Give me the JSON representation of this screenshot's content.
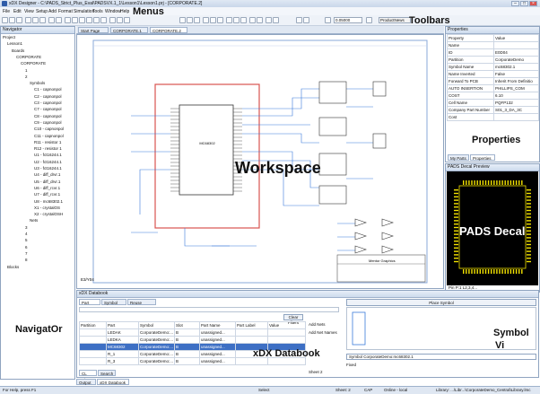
{
  "window": {
    "title": "xDX Designer - C:\\PADS_Strict_Plus_Eval\\PADSVX.1_1\\Lesson1\\Lesson1.prj - [CORPORATE.2]",
    "min": "–",
    "max": "□",
    "close": "×"
  },
  "annotations": {
    "menus": "Menus",
    "toolbars": "Toolbars",
    "workspace": "Workspace",
    "navigator": "NavigatOr",
    "properties": "Properties",
    "pads_decal": "PADS Decal",
    "symbol": "Symbol",
    "symbol_line2": "Vi",
    "xdx_database": "xDX Databook"
  },
  "menu": [
    "File",
    "Edit",
    "View",
    "Setup",
    "Add",
    "Format",
    "Simulation",
    "Tools",
    "Window",
    "Help"
  ],
  "toolbar": {
    "zoom_value": "0.05000",
    "product_name": "ProductNews"
  },
  "navigator": {
    "header": "Navigator",
    "tree": [
      {
        "label": "Project",
        "depth": 0
      },
      {
        "label": "Lesson1",
        "depth": 1
      },
      {
        "label": "Boards",
        "depth": 2
      },
      {
        "label": "CORPORATE",
        "depth": 3
      },
      {
        "label": "CORPORATE",
        "depth": 4
      },
      {
        "label": "1",
        "depth": 5
      },
      {
        "label": "2",
        "depth": 5
      },
      {
        "label": "Symbols",
        "depth": 6
      },
      {
        "label": "C1 - capnonpol",
        "depth": 7
      },
      {
        "label": "C2 - capnonpol",
        "depth": 7
      },
      {
        "label": "C3 - capnonpol",
        "depth": 7
      },
      {
        "label": "C7 - capnonpol",
        "depth": 7
      },
      {
        "label": "C8 - capnonpol",
        "depth": 7
      },
      {
        "label": "C9 - capnonpol",
        "depth": 7
      },
      {
        "label": "C10 - capnonpol",
        "depth": 7
      },
      {
        "label": "C11 - capnonpol",
        "depth": 7
      },
      {
        "label": "R11 - resistor 1",
        "depth": 7
      },
      {
        "label": "R12 - resistor 1",
        "depth": 7
      },
      {
        "label": "U1 - fct16244.1",
        "depth": 7
      },
      {
        "label": "U2 - fct16244.1",
        "depth": 7
      },
      {
        "label": "U3 - fct16244.1",
        "depth": 7
      },
      {
        "label": "U4 - diff_drvr.1",
        "depth": 7
      },
      {
        "label": "U5 - diff_drvr.1",
        "depth": 7
      },
      {
        "label": "U6 - diff_rcvr.1",
        "depth": 7
      },
      {
        "label": "U7 - diff_rcvr.1",
        "depth": 7
      },
      {
        "label": "U8 - mc68302.1",
        "depth": 7
      },
      {
        "label": "X1 - crystalOS",
        "depth": 7
      },
      {
        "label": "X2 - crystalOSH",
        "depth": 7
      },
      {
        "label": "Nets",
        "depth": 6
      },
      {
        "label": "3",
        "depth": 5
      },
      {
        "label": "4",
        "depth": 5
      },
      {
        "label": "5",
        "depth": 5
      },
      {
        "label": "6",
        "depth": 5
      },
      {
        "label": "7",
        "depth": 5
      },
      {
        "label": "8",
        "depth": 5
      },
      {
        "label": "Blocks",
        "depth": 1
      }
    ]
  },
  "doc_tabs": [
    "Start Page",
    "CORPORATE.1",
    "CORPORATE.2"
  ],
  "schematic": {
    "sheet_label": "E3/Y04",
    "title_block": "Mentor Graphics",
    "chip_label": "MC68302"
  },
  "properties": {
    "header": "Properties",
    "col_property": "Property",
    "col_value": "Value",
    "rows": [
      {
        "name": "Name",
        "value": ""
      },
      {
        "name": "ID",
        "value": "E0D04"
      },
      {
        "name": "Partition",
        "value": "CorporateDemo"
      },
      {
        "name": "Symbol Name",
        "value": "mc68302.1"
      },
      {
        "name": "Name Inverted",
        "value": "False"
      },
      {
        "name": "Forward To PCB",
        "value": "Inherit From Definitio"
      },
      {
        "name": "AUTO INSERTION",
        "value": "PHILLIPS_COM"
      },
      {
        "name": "COST",
        "value": "6.10"
      },
      {
        "name": "Cell Name",
        "value": "PQFP132"
      },
      {
        "name": "Company Part Number",
        "value": "S01_3_DA_3C"
      },
      {
        "name": "Cost",
        "value": ""
      }
    ],
    "tabs": [
      "My Parts",
      "Properties"
    ]
  },
  "decal": {
    "header": "PADS Decal Preview",
    "pin_text": "Pin  P:1  L2,3,4..."
  },
  "database": {
    "header": "xDX Databook",
    "tabs": [
      "Part View",
      "Symbol View",
      "Reuse Blocks"
    ],
    "clear_filters": "Clear Filters",
    "add_nets": "Add Nets",
    "add_net_names": "Add Net Names",
    "columns": [
      "Partition",
      "Part",
      "Symbol",
      "Slot",
      "Part Name",
      "Part Label",
      "Value"
    ],
    "rows": [
      [
        "",
        "LEDAK",
        "CorporateDemo:...",
        "B",
        "unassigned...",
        "",
        ""
      ],
      [
        "",
        "LEDKA",
        "CorporateDemo:...",
        "B",
        "unassigned...",
        "",
        ""
      ],
      [
        "",
        "MC68302",
        "CorporateDemo:...",
        "B",
        "unassigned...",
        "",
        ""
      ],
      [
        "",
        "R_1",
        "CorporateDemo:...",
        "B",
        "unassigned...",
        "",
        ""
      ],
      [
        "",
        "R_3",
        "CorporateDemo:...",
        "B",
        "unassigned...",
        "",
        ""
      ]
    ],
    "bottom_tabs": [
      "CL View",
      "Search"
    ],
    "sheet_tab": "Sheet 2",
    "place_symbol": "Place Symbol",
    "symbol_select": "Symbol CorporateDemo:mc68302.1",
    "fixed_label": "Fixed"
  },
  "output_tabs": [
    "Output",
    "xDX Databook"
  ],
  "status": {
    "left": "For Help, press F1",
    "mid": "Select",
    "sheet": "Sheet: 2",
    "caps": "CAP",
    "online": "Online - local",
    "library": "Library: ...\\Libr...\\CorporateDemo_Central\\Library.lmc"
  },
  "colors": {
    "schematic_border": "#d9534f",
    "wire": "#3a7ad9",
    "decal_bg": "#000000",
    "decal_pin": "#f2e200"
  }
}
